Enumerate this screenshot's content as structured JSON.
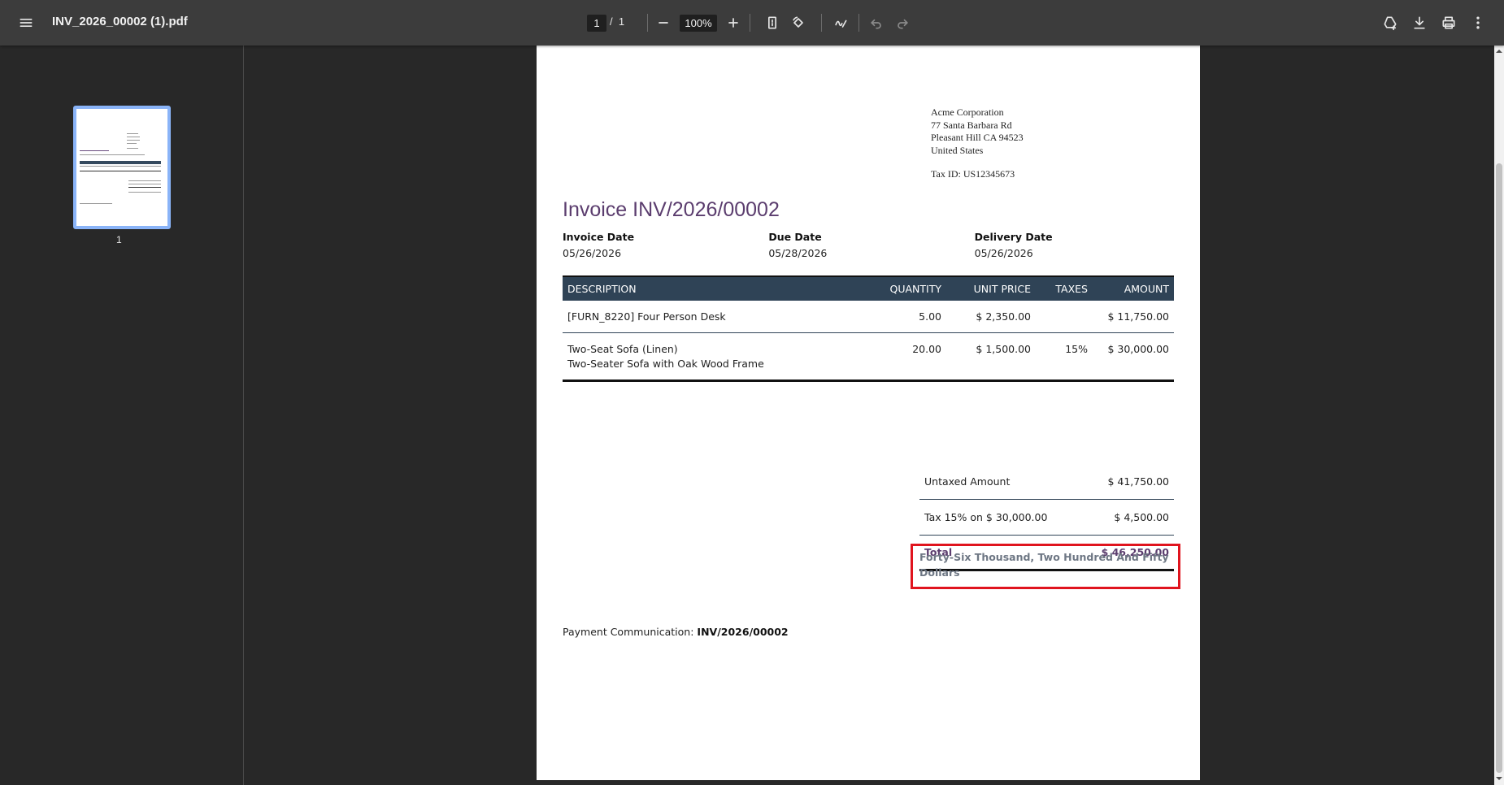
{
  "toolbar": {
    "file_name": "INV_2026_00002 (1).pdf",
    "current_page": "1",
    "page_separator": "/",
    "total_pages": "1",
    "zoom": "100%"
  },
  "sidebar": {
    "thumbnail_page_number": "1"
  },
  "invoice": {
    "company": {
      "name": "Acme Corporation",
      "street": "77 Santa Barbara Rd",
      "city": "Pleasant Hill CA 94523",
      "country": "United States",
      "tax_id": "Tax ID: US12345673"
    },
    "title": "Invoice INV/2026/00002",
    "dates": [
      {
        "label": "Invoice Date",
        "value": "05/26/2026"
      },
      {
        "label": "Due Date",
        "value": "05/28/2026"
      },
      {
        "label": "Delivery Date",
        "value": "05/26/2026"
      }
    ],
    "columns": [
      "DESCRIPTION",
      "QUANTITY",
      "UNIT PRICE",
      "TAXES",
      "AMOUNT"
    ],
    "lines": [
      {
        "description": "[FURN_8220] Four Person Desk",
        "subdescription": "",
        "quantity": "5.00",
        "unit_price": "$ 2,350.00",
        "taxes": "",
        "amount": "$ 11,750.00"
      },
      {
        "description": "Two-Seat Sofa (Linen)",
        "subdescription": "Two-Seater Sofa with Oak Wood Frame",
        "quantity": "20.00",
        "unit_price": "$ 1,500.00",
        "taxes": "15%",
        "amount": "$ 30,000.00"
      }
    ],
    "totals": {
      "untaxed_label": "Untaxed Amount",
      "untaxed_value": "$ 41,750.00",
      "tax_label": "Tax 15% on $ 30,000.00",
      "tax_value": "$ 4,500.00",
      "total_label": "Total",
      "total_value": "$ 46,250.00"
    },
    "amount_in_words": "Forty-Six Thousand, Two Hundred And Fifty Dollars",
    "payment_label": "Payment Communication:",
    "payment_reference": "INV/2026/00002"
  },
  "colors": {
    "toolbar_bg": "#3c3c3c",
    "viewer_bg": "#282828",
    "table_header_bg": "#2f4356",
    "title_purple": "#5b3d6e",
    "highlight_red": "#e0141e",
    "thumb_border": "#8ab4f8"
  }
}
